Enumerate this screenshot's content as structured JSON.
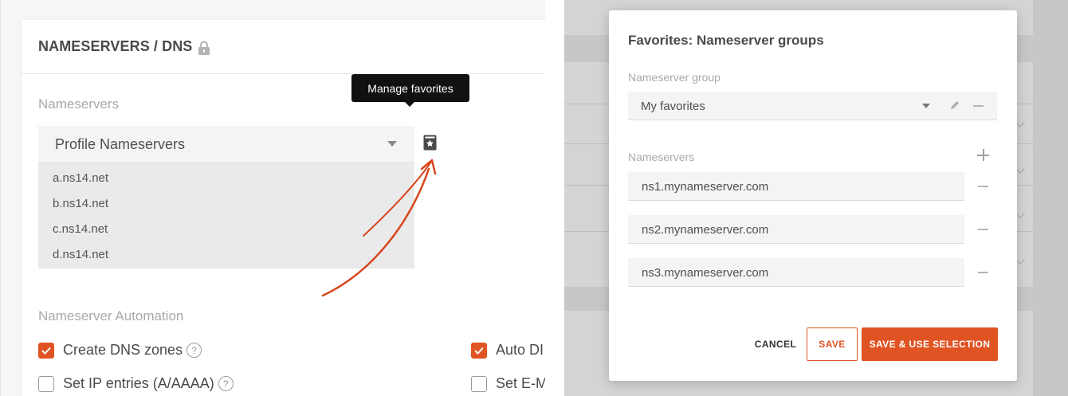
{
  "colors": {
    "accent": "#e05423",
    "text": "#4a4a4a",
    "muted": "#a9a9a9",
    "tooltip_bg": "#111111"
  },
  "left_panel": {
    "card_title": "NAMESERVERS / DNS",
    "title_icon": "lock-icon",
    "nameservers_label": "Nameservers",
    "select_value": "Profile Nameservers",
    "nameserver_list": [
      "a.ns14.net",
      "b.ns14.net",
      "c.ns14.net",
      "d.ns14.net"
    ],
    "favorites_icon": "bookmark-star-icon",
    "tooltip": "Manage favorites",
    "automation_label": "Nameserver Automation",
    "options": [
      {
        "label": "Create DNS zones",
        "checked": true,
        "help": true
      },
      {
        "label": "Set IP entries (A/AAAA)",
        "checked": false,
        "help": true
      },
      {
        "label": "Auto DI",
        "checked": true,
        "help": false
      },
      {
        "label": "Set E-M",
        "checked": false,
        "help": false
      }
    ],
    "help_glyph": "?"
  },
  "modal": {
    "title": "Favorites: Nameserver groups",
    "group_label": "Nameserver group",
    "group_value": "My favorites",
    "nameservers_label": "Nameservers",
    "nameservers": [
      "ns1.mynameserver.com",
      "ns2.mynameserver.com",
      "ns3.mynameserver.com"
    ],
    "buttons": {
      "cancel": "CANCEL",
      "save": "SAVE",
      "save_use": "SAVE & USE SELECTION"
    }
  }
}
